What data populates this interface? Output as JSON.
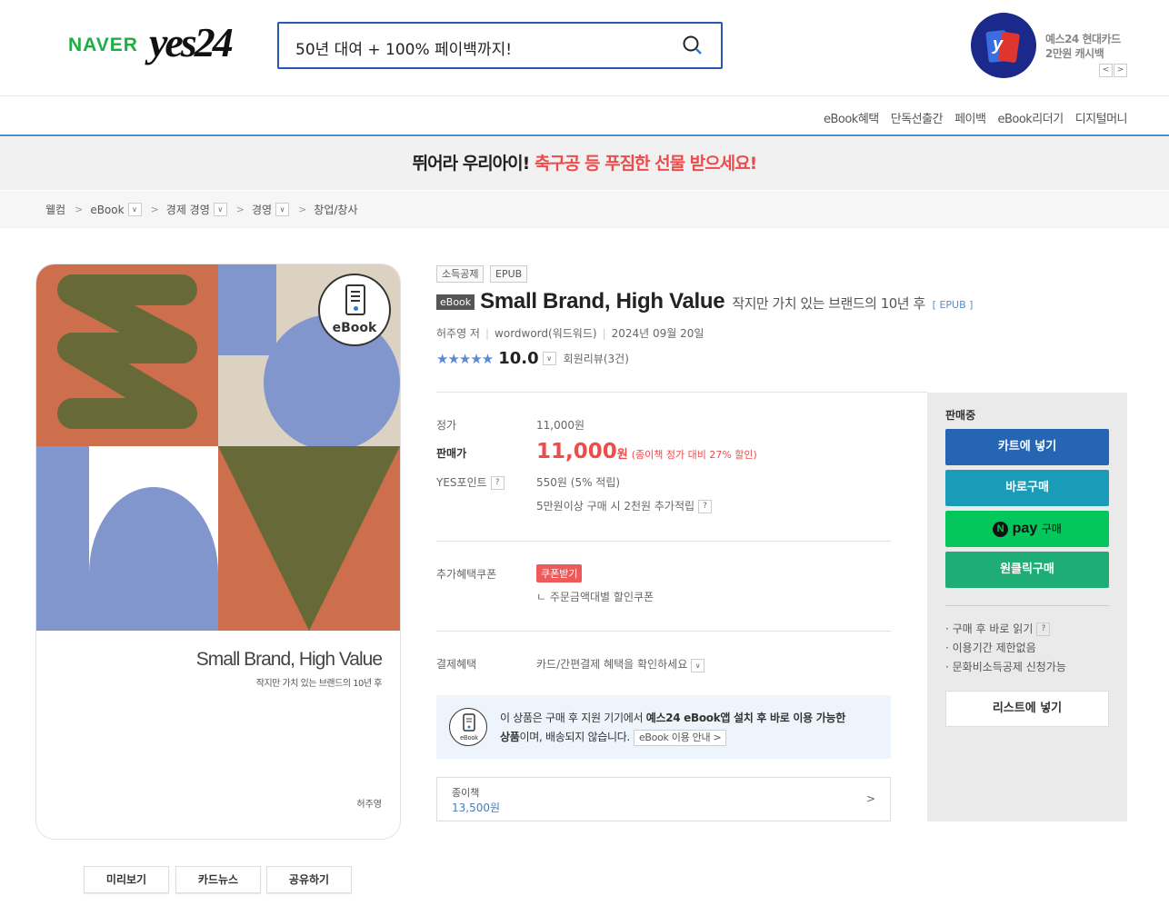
{
  "header": {
    "naver": "NAVER",
    "logo": "yes24",
    "search_value": "50년 대여 + 100% 페이백까지!",
    "promo_line1": "예스24 현대카드",
    "promo_line2": "2만원 캐시백",
    "promo_prev": "<",
    "promo_next": ">"
  },
  "subnav": [
    "eBook혜택",
    "단독선출간",
    "페이백",
    "eBook리더기",
    "디지털머니"
  ],
  "banner": {
    "part1": "뛰어라 우리아이!",
    "part2": "축구공 등 푸짐한 선물 받으세요!"
  },
  "breadcrumb": [
    "웰컴",
    "eBook",
    "경제 경영",
    "경영",
    "창업/창사"
  ],
  "cover": {
    "badge": "eBook",
    "title": "Small Brand, High Value",
    "subtitle": "작지만 가치 있는 브랜드의 10년 후",
    "author": "허주영"
  },
  "cover_buttons": [
    "미리보기",
    "카드뉴스",
    "공유하기"
  ],
  "product": {
    "tags": [
      "소득공제",
      "EPUB"
    ],
    "ebook_label": "eBook",
    "title": "Small Brand, High Value",
    "subtitle": "작지만 가치 있는 브랜드의 10년 후",
    "format": "[ EPUB ]",
    "author": "허주영 저",
    "publisher": "wordword(워드워드)",
    "date": "2024년 09월 20일",
    "stars": "★★★★★",
    "score": "10.0",
    "review": "회원리뷰(3건)"
  },
  "price": {
    "list_label": "정가",
    "list_value": "11,000원",
    "sale_label": "판매가",
    "sale_value": "11,000",
    "sale_unit": "원",
    "sale_discount": "(종이책 정가 대비 27% 할인)",
    "point_label": "YES포인트",
    "point_value": "550원 (5% 적립)",
    "point_extra": "5만원이상 구매 시 2천원 추가적립",
    "q": "?"
  },
  "coupon": {
    "label": "추가혜택쿠폰",
    "button": "쿠폰받기",
    "note": "ㄴ 주문금액대별 할인쿠폰"
  },
  "payment": {
    "label": "결제혜택",
    "value": "카드/간편결제 혜택을 확인하세요"
  },
  "notice": {
    "icon_label": "eBook",
    "line1_a": "이 상품은 구매 후 지원 기기에서 ",
    "line1_b": "예스24 eBook앱 설치 후 바로 이용 가능한",
    "line2_a": "상품",
    "line2_b": "이며, 배송되지 않습니다.",
    "pill": "eBook 이용 안내 >"
  },
  "paper_book": {
    "label": "종이책",
    "price": "13,500원",
    "arrow": ">"
  },
  "sidebar": {
    "status": "판매중",
    "cart": "카트에 넣기",
    "buy_now": "바로구매",
    "npay": "pay",
    "npay_suffix": "구매",
    "one_click": "원클릭구매",
    "notes": [
      "· 구매 후 바로 읽기",
      "· 이용기간 제한없음",
      "· 문화비소득공제 신청가능"
    ],
    "wishlist": "리스트에 넣기"
  },
  "colors": {
    "accent": "#2a5ab0",
    "cart": "#2565b3",
    "buy": "#1a9cb8",
    "npay": "#03c75a",
    "oneclick": "#1fad76",
    "sale": "#ee4b4b"
  }
}
